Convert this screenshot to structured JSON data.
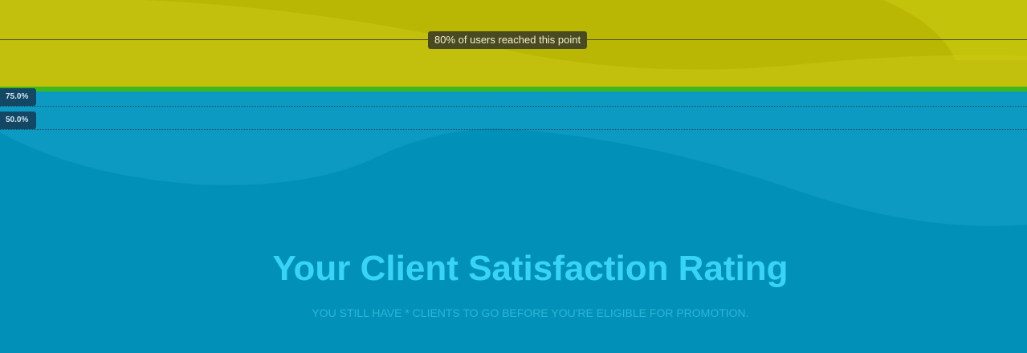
{
  "funnel": {
    "tooltip": "80% of users reached this point",
    "thresholds": [
      "75.0%",
      "50.0%"
    ],
    "reached_percent": 80
  },
  "hero": {
    "title": "Your Client Satisfaction Rating",
    "subtitle": "YOU STILL HAVE * CLIENTS TO GO BEFORE YOU'RE ELIGIBLE FOR PROMOTION."
  },
  "colors": {
    "yellow": "#c2c00c",
    "green": "#3fb81a",
    "blue": "#0c9ac3",
    "title": "#38d4f8"
  }
}
